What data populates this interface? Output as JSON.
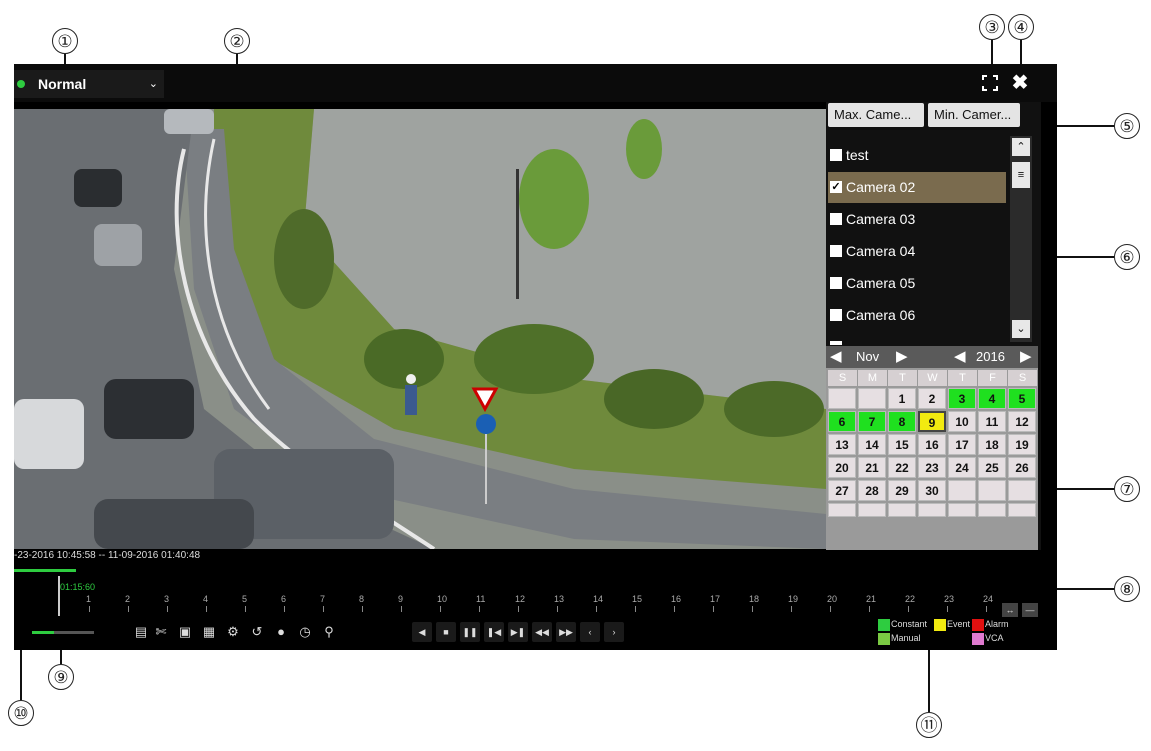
{
  "callouts": [
    "①",
    "②",
    "③",
    "④",
    "⑤",
    "⑥",
    "⑦",
    "⑧",
    "⑨",
    "⑩",
    "⑪"
  ],
  "header": {
    "mode_value": "Normal",
    "fullscreen_icon": "fullscreen-icon",
    "close_icon": "close-icon"
  },
  "panel": {
    "max_button": "Max. Came...",
    "min_button": "Min. Camer...",
    "cameras": [
      {
        "label": "test",
        "checked": false
      },
      {
        "label": "Camera 02",
        "checked": true
      },
      {
        "label": "Camera 03",
        "checked": false
      },
      {
        "label": "Camera 04",
        "checked": false
      },
      {
        "label": "Camera 05",
        "checked": false
      },
      {
        "label": "Camera 06",
        "checked": false
      }
    ]
  },
  "calendar": {
    "month": "Nov",
    "year": "2016",
    "weekdays": [
      "S",
      "M",
      "T",
      "W",
      "T",
      "F",
      "S"
    ],
    "days": [
      "",
      "",
      "1",
      "2",
      "3",
      "4",
      "5",
      "6",
      "7",
      "8",
      "9",
      "10",
      "11",
      "12",
      "13",
      "14",
      "15",
      "16",
      "17",
      "18",
      "19",
      "20",
      "21",
      "22",
      "23",
      "24",
      "25",
      "26",
      "27",
      "28",
      "29",
      "30",
      "",
      "",
      ""
    ],
    "recorded_days": [
      "3",
      "4",
      "5",
      "6",
      "7",
      "8"
    ],
    "selected_day": "9"
  },
  "timeline": {
    "range": "-23-2016 10:45:58 -- 11-09-2016 01:40:48",
    "cursor_time": "01:15:60",
    "hours": [
      "1",
      "2",
      "3",
      "4",
      "5",
      "6",
      "7",
      "8",
      "9",
      "10",
      "11",
      "12",
      "13",
      "14",
      "15",
      "16",
      "17",
      "18",
      "19",
      "20",
      "21",
      "22",
      "23",
      "24"
    ]
  },
  "legend": {
    "constant": "Constant",
    "event": "Event",
    "alarm": "Alarm",
    "manual": "Manual",
    "vca": "VCA",
    "colors": {
      "constant": "#2ecc40",
      "event": "#f2ea10",
      "alarm": "#e01010",
      "manual": "#7ac943",
      "vca": "#e07ad0"
    }
  }
}
